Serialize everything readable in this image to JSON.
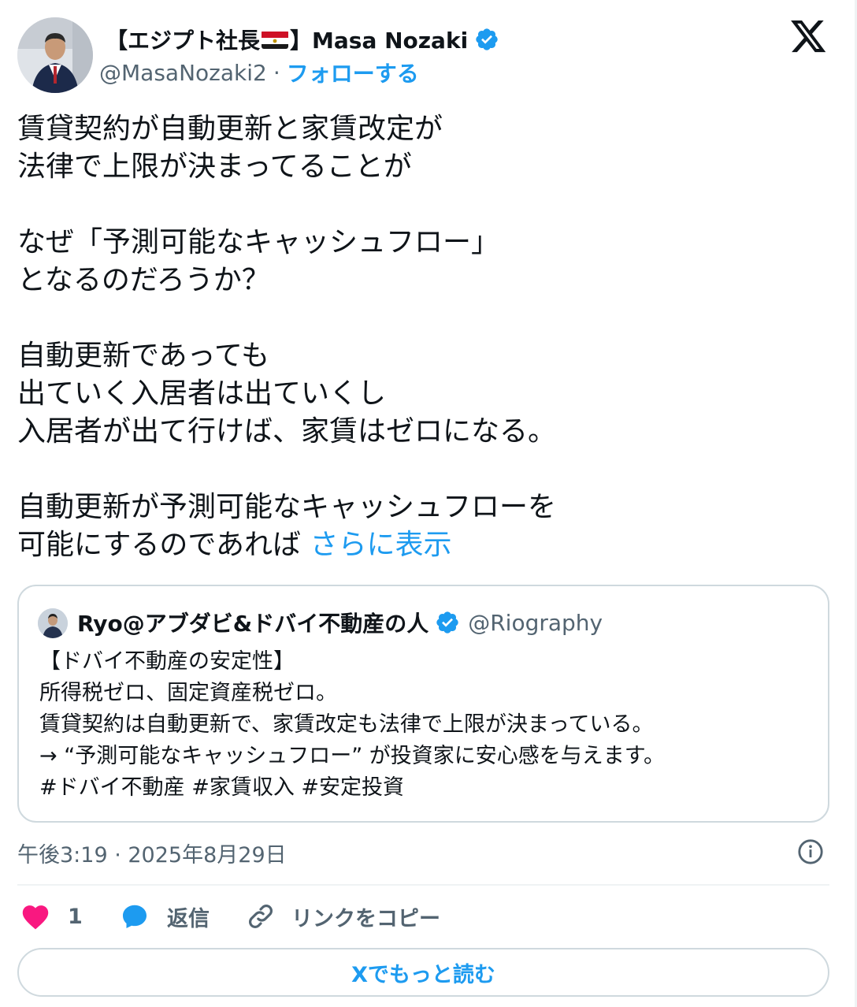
{
  "author": {
    "display_name_prefix": "【エジプト社長",
    "display_name_suffix": "】Masa Nozaki",
    "handle": "@MasaNozaki2",
    "separator": "·",
    "follow_label": "フォローする"
  },
  "tweet": {
    "lines": [
      "賃貸契約が自動更新と家賃改定が",
      "法律で上限が決まってることが",
      "",
      "なぜ「予測可能なキャッシュフロー」",
      "となるのだろうか？",
      "",
      "自動更新であっても",
      "出ていく入居者は出ていくし",
      "入居者が出て行けば、家賃はゼロになる。",
      "",
      "自動更新が予測可能なキャッシュフローを"
    ],
    "last_line": "可能にするのであれば ",
    "show_more_label": "さらに表示"
  },
  "quoted": {
    "name": "Ryo@アブダビ&ドバイ不動産の人",
    "handle": "@Riography",
    "lines": [
      "【ドバイ不動産の安定性】",
      "所得税ゼロ、固定資産税ゼロ。",
      "賃貸契約は自動更新で、家賃改定も法律で上限が決まっている。",
      "→ “予測可能なキャッシュフロー” が投資家に安心感を与えます。",
      "#ドバイ不動産 #家賃収入 #安定投資"
    ]
  },
  "meta": {
    "timestamp": "午後3:19 · 2025年8月29日"
  },
  "actions": {
    "like_count": "1",
    "reply_label": "返信",
    "copy_link_label": "リンクをコピー"
  },
  "read_more_label": "Xでもっと読む",
  "colors": {
    "accent": "#1d9bf0",
    "like": "#f91880",
    "text": "#0f1419",
    "muted": "#536471",
    "border": "#cfd9de"
  },
  "icons": [
    "x-logo-icon",
    "verified-badge-icon",
    "egypt-flag-icon",
    "info-icon",
    "heart-icon",
    "reply-bubble-icon",
    "link-icon"
  ]
}
